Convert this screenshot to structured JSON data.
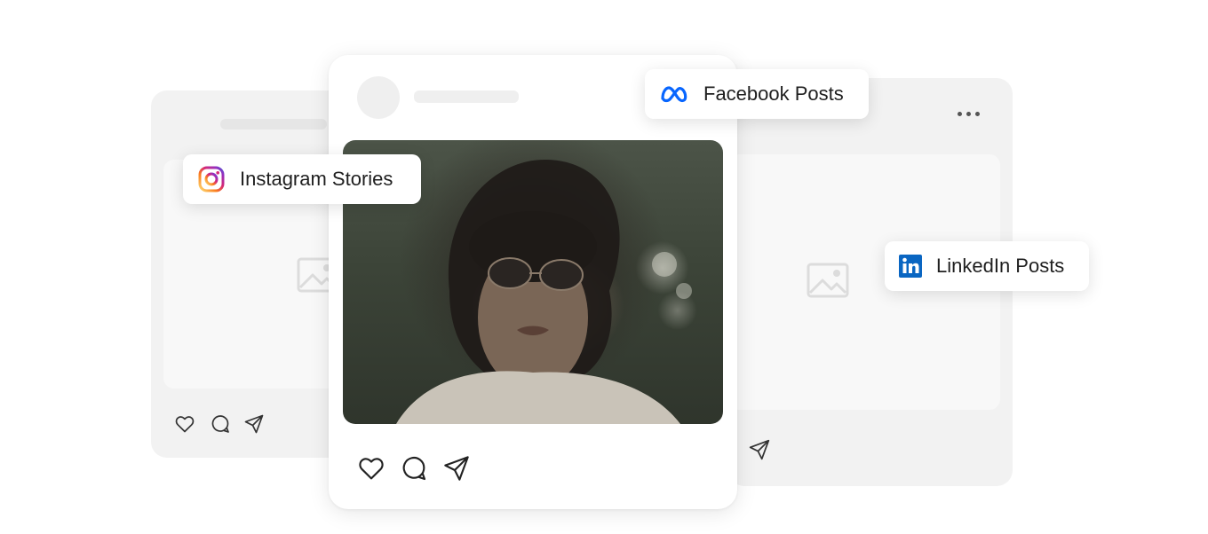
{
  "badges": {
    "facebook": {
      "label": "Facebook Posts",
      "icon": "meta-logo-icon",
      "color": "#0866ff"
    },
    "instagram": {
      "label": "Instagram Stories",
      "icon": "instagram-logo-icon"
    },
    "linkedin": {
      "label": "LinkedIn Posts",
      "icon": "linkedin-logo-icon",
      "color": "#0a66c2"
    }
  },
  "icons": {
    "like": "heart-icon",
    "comment": "comment-icon",
    "share": "send-icon",
    "more": "more-dots-icon",
    "image_placeholder": "image-placeholder-icon"
  },
  "colors": {
    "card_back": "#f2f2f2",
    "card_front": "#ffffff",
    "icon_stroke": "#222222"
  }
}
